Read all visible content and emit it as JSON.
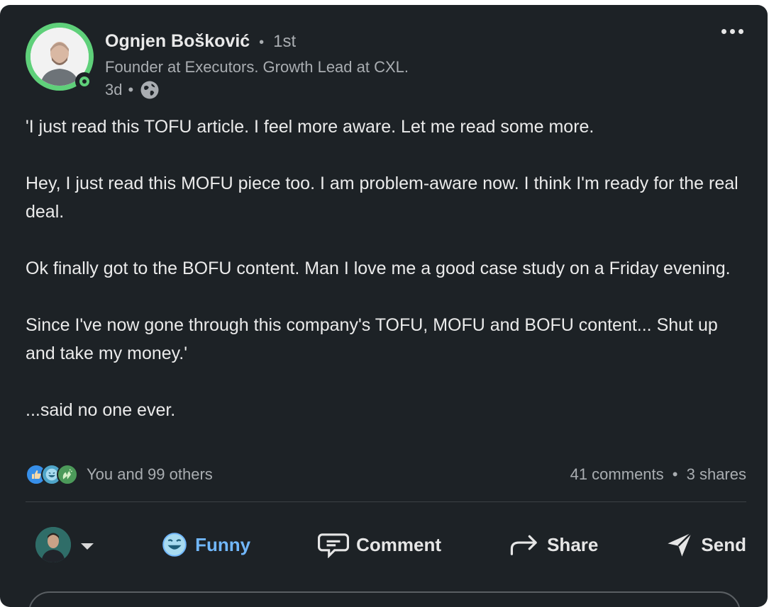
{
  "author": {
    "name": "Ognjen Bošković",
    "separator": "•",
    "degree": "1st",
    "headline": "Founder at Executors. Growth Lead at CXL.",
    "time": "3d",
    "meta_separator": "•",
    "visibility_icon": "globe-icon"
  },
  "post": {
    "paragraphs": [
      "'I just read this TOFU article. I feel more aware. Let me read some more.",
      "Hey, I just read this MOFU piece too. I am problem-aware now. I think I'm ready for the real deal.",
      "Ok finally got to the BOFU content. Man I love me a good case study on a Friday evening.",
      "Since I've now gone through this company's TOFU, MOFU and BOFU content... Shut up and take my money.'",
      "...said no one ever."
    ]
  },
  "social": {
    "reaction_icons": [
      "like-icon",
      "funny-icon",
      "celebrate-icon"
    ],
    "reactions_text": "You and 99 others",
    "comments": "41 comments",
    "stat_separator": "•",
    "shares": "3 shares"
  },
  "actions": {
    "reaction_label": "Funny",
    "comment_label": "Comment",
    "share_label": "Share",
    "send_label": "Send"
  },
  "colors": {
    "background": "#1d2226",
    "accent_blue": "#71b7fb",
    "online_green": "#5fd07a",
    "text_primary": "#ebebeb",
    "text_secondary": "#a9adb1"
  }
}
